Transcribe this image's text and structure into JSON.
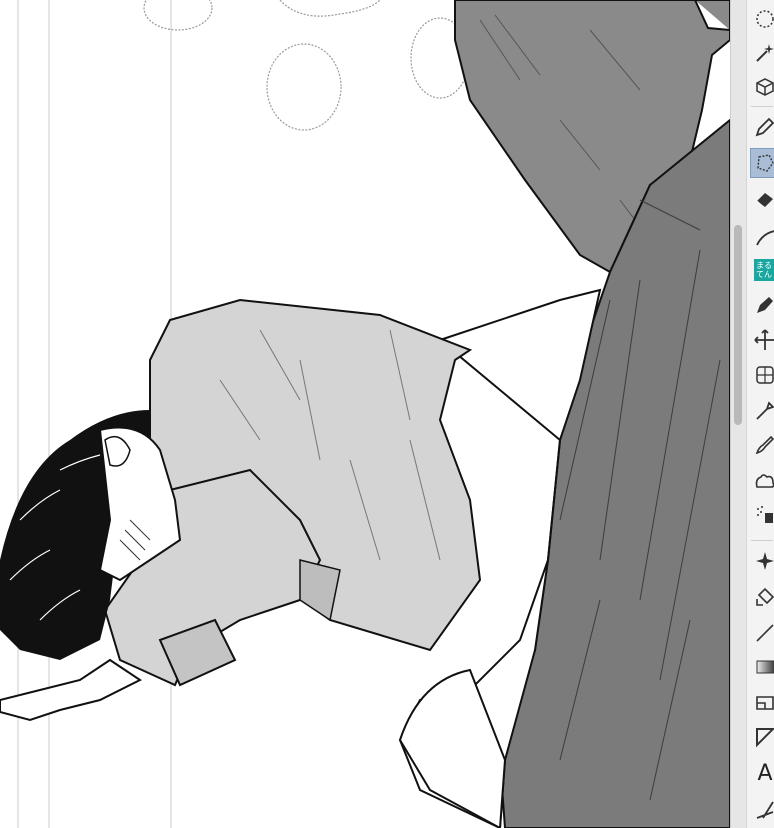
{
  "canvas": {
    "background": "#ffffff",
    "guide_color": "#c9c9d6",
    "tone_light": "#d2d2d2",
    "tone_dark": "#8a8a8a",
    "tone_darker": "#6f6f6f"
  },
  "toolbar": {
    "maru_label_line1": "まる",
    "maru_label_line2": "てん",
    "text_tool_glyph": "A",
    "tools": [
      "lasso-select-icon",
      "magic-wand-icon",
      "3d-object-icon",
      "pen-icon",
      "selection-marquee-icon",
      "eraser-icon",
      "line-icon",
      "maruten-tool",
      "fill-pen-icon",
      "move-icon",
      "perspective-grid-icon",
      "dropper-icon",
      "brush-icon",
      "cloud-brush-icon",
      "spray-icon",
      "sparkle-icon",
      "bucket-fill-icon",
      "ruler-line-icon",
      "gradient-icon",
      "frame-border-icon",
      "balloon-tail-icon",
      "text-tool-icon",
      "pen-ruler-icon"
    ],
    "active_tool": "selection-marquee-icon"
  }
}
